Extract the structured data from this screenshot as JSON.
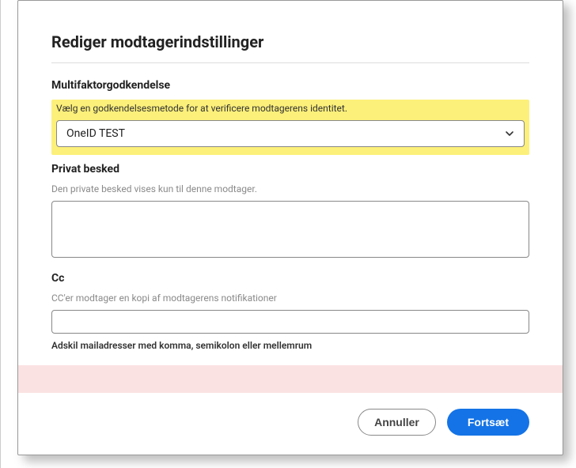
{
  "modal": {
    "title": "Rediger modtagerindstillinger",
    "mfa": {
      "header": "Multifaktorgodkendelse",
      "helper": "Vælg en godkendelsesmetode for at verificere modtagerens identitet.",
      "selected": "OneID TEST"
    },
    "privateMessage": {
      "header": "Privat besked",
      "helper": "Den private besked vises kun til denne modtager.",
      "value": ""
    },
    "cc": {
      "header": "Cc",
      "helper": "CC'er modtager en kopi af modtagerens notifikationer",
      "value": "",
      "hint": "Adskil mailadresser med komma, semikolon eller mellemrum"
    },
    "footer": {
      "cancel": "Annuller",
      "continue": "Fortsæt"
    }
  }
}
